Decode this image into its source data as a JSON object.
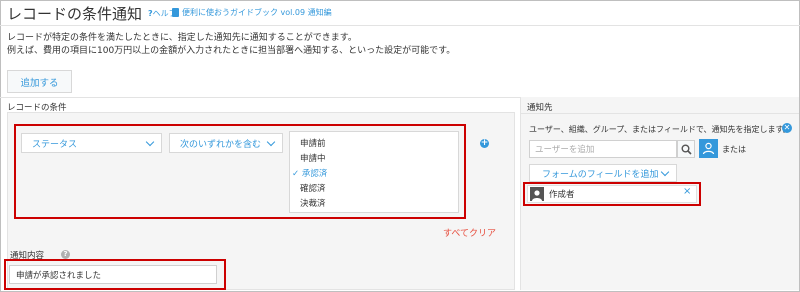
{
  "header": {
    "title": "レコードの条件通知",
    "help_label": "ヘルプ",
    "guide_label": "便利に使おうガイドブック vol.09 通知編"
  },
  "description": {
    "line1": "レコードが特定の条件を満たしたときに、指定した通知先に通知することができます。",
    "line2": "例えば、費用の項目に100万円以上の金額が入力されたときに担当部署へ通知する、といった設定が可能です。"
  },
  "toolbar": {
    "add_label": "追加する"
  },
  "conditions": {
    "section_label": "レコードの条件",
    "field_dropdown": "ステータス",
    "operator_dropdown": "次のいずれかを含む",
    "options": [
      {
        "label": "申請前",
        "checked": false
      },
      {
        "label": "申請中",
        "checked": false
      },
      {
        "label": "承認済",
        "checked": true
      },
      {
        "label": "確認済",
        "checked": false
      },
      {
        "label": "決裁済",
        "checked": false
      }
    ],
    "check_mark": "✓",
    "clear_label": "すべてクリア",
    "add_symbol": "+"
  },
  "message": {
    "label": "通知内容",
    "help_symbol": "?",
    "value": "申請が承認されました"
  },
  "recipients": {
    "section_label": "通知先",
    "hint": "ユーザー、組織、グループ、またはフィールドで、通知先を指定します。",
    "search_placeholder": "ユーザーを追加",
    "or_label": "または",
    "form_field_button": "フォームのフィールドを追加",
    "chip_label": "作成者",
    "remove_symbol": "×",
    "close_symbol": "✕"
  },
  "colors": {
    "accent": "#3498db",
    "danger": "#e74c3c",
    "highlight": "#cc0000"
  }
}
